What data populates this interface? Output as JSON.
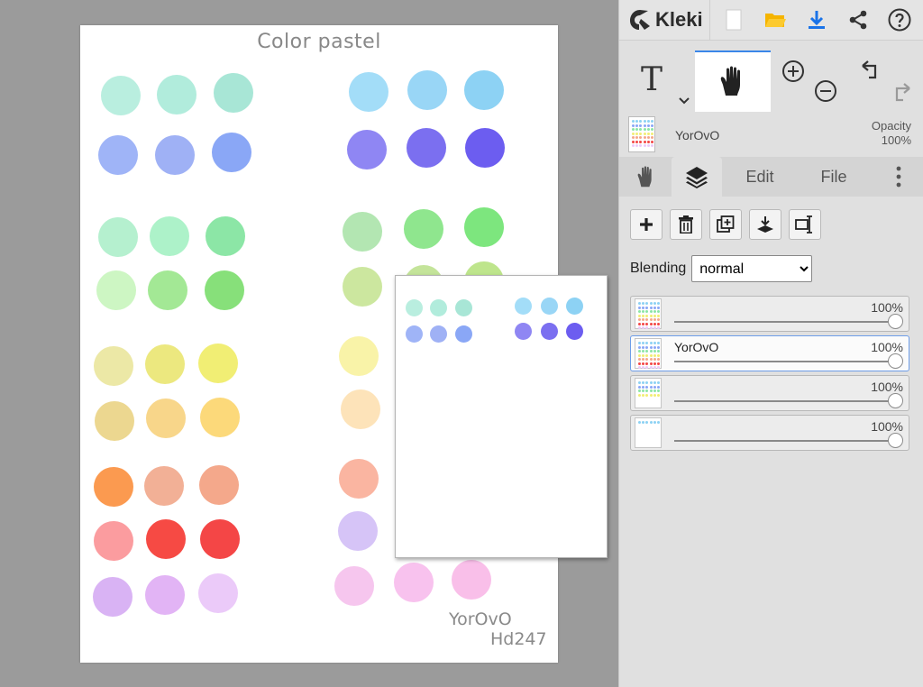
{
  "canvas": {
    "title": "Color pastel",
    "signature": "YorOvO",
    "signature2": "Hd247",
    "swatches": [
      "#b9eedf",
      "#b1ecdc",
      "#a8e6d6",
      "#9fb4f7",
      "#9fb1f5",
      "#8aa7f6",
      "#a3ddf8",
      "#99d6f6",
      "#8dd2f4",
      "#8f86f3",
      "#7b6ff0",
      "#6c5df0",
      "#b5f0cf",
      "#adf2c9",
      "#8ce6a6",
      "#b3e6b2",
      "#8fe68e",
      "#7de67e",
      "#cdf6c3",
      "#a3e895",
      "#87e07a",
      "#cce79f",
      "#c4e49a",
      "#bee58c",
      "#ece8a6",
      "#ece87f",
      "#f1ee74",
      "#f9f3a8",
      "#ecd790",
      "#f8d68a",
      "#fcd97a",
      "#fde3b9",
      "#fb9a50",
      "#f2b096",
      "#f4a88b",
      "#fab5a1",
      "#fb9c9f",
      "#f64a44",
      "#f44646",
      "#d6c4f7",
      "#d9b3f4",
      "#e2b4f5",
      "#ebcaf9",
      "#f6c6ee",
      "#f8c2ee",
      "#f9bfe9"
    ]
  },
  "preview": {
    "swatches": [
      "#b9eedf",
      "#b1ecdc",
      "#a8e6d6",
      "#a3ddf8",
      "#99d6f6",
      "#8dd2f4",
      "#9fb4f7",
      "#9fb1f5",
      "#8aa7f6",
      "#8f86f3",
      "#7b6ff0",
      "#6c5df0"
    ]
  },
  "topbar": {
    "logo": "Kleki",
    "icons": [
      "new-image-icon",
      "open-folder-icon",
      "download-icon",
      "share-icon",
      "help-icon"
    ]
  },
  "toolbar": {
    "text_tool": "T",
    "icons": [
      "text-tool-icon",
      "hand-tool-icon",
      "zoom-in-icon",
      "zoom-out-icon",
      "undo-icon",
      "redo-icon"
    ]
  },
  "layer_info": {
    "name": "YorOvO",
    "opacity_label": "Opacity",
    "opacity_value": "100%"
  },
  "tabs": {
    "hand_icon": "hand-icon",
    "layers_icon": "layers-icon",
    "edit": "Edit",
    "file": "File",
    "more_icon": "more-vertical-icon"
  },
  "layer_actions": [
    "add-layer-icon",
    "delete-layer-icon",
    "duplicate-layer-icon",
    "merge-down-icon",
    "rename-layer-icon"
  ],
  "blending": {
    "label": "Blending",
    "value": "normal",
    "options": [
      "normal"
    ]
  },
  "layers": [
    {
      "name": "",
      "opacity": "100%",
      "opacity_value": 1.0,
      "selected": false
    },
    {
      "name": "YorOvO",
      "opacity": "100%",
      "opacity_value": 1.0,
      "selected": true
    },
    {
      "name": "",
      "opacity": "100%",
      "opacity_value": 1.0,
      "selected": false
    },
    {
      "name": "",
      "opacity": "100%",
      "opacity_value": 1.0,
      "selected": false
    }
  ],
  "colors": {
    "accent": "#3a86e8",
    "download": "#1a73e8",
    "folder": "#f5b400",
    "panel_bg": "#e0e0e0",
    "workspace_bg": "#9b9b9b"
  }
}
